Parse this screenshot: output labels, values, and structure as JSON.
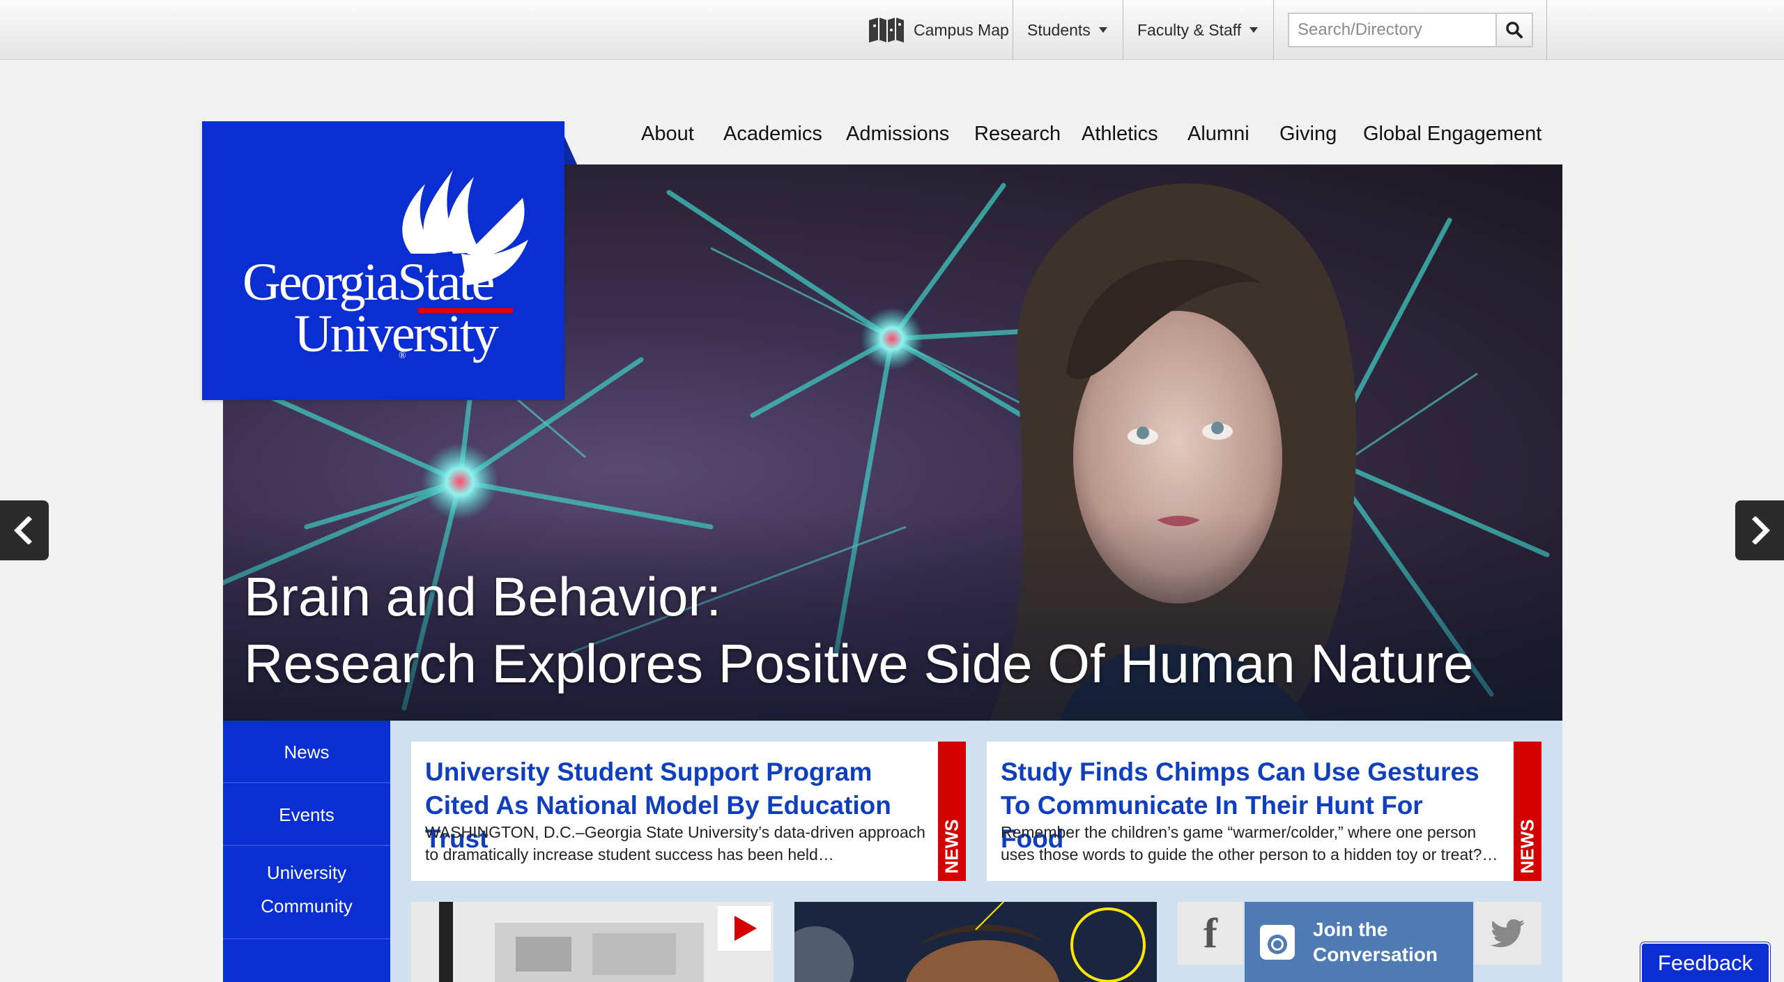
{
  "utility": {
    "campus_map": "Campus Map",
    "students": "Students",
    "faculty_staff": "Faculty & Staff",
    "search_placeholder": "Search/Directory"
  },
  "logo": {
    "line1": "GeorgiaState",
    "line2": "University"
  },
  "nav": [
    "About",
    "Academics",
    "Admissions",
    "Research",
    "Athletics",
    "Alumni",
    "Giving",
    "Global Engagement"
  ],
  "hero": {
    "title_line1": "Brain and Behavior:",
    "title_line2": "Research Explores Positive Side Of Human Nature"
  },
  "sidebar": [
    "News",
    "Events",
    "University Community"
  ],
  "cards": [
    {
      "title": "University Student Support Program Cited As National Model By Education Trust",
      "excerpt": "WASHINGTON, D.C.–Georgia State University’s data-driven approach to dramatically increase student success has been held…",
      "tag": "NEWS"
    },
    {
      "title": "Study Finds Chimps Can Use Gestures To Communicate In Their Hunt For Food",
      "excerpt": "Remember the children’s game “warmer/colder,” where one person uses those words to guide the other person to a hidden toy or treat?…",
      "tag": "NEWS"
    }
  ],
  "social": {
    "join": "Join the Conversation",
    "facebook_glyph": "f"
  },
  "feedback": "Feedback",
  "colors": {
    "brand_blue": "#0a2ed1",
    "news_red": "#d40000",
    "link_blue": "#0f3fbd"
  }
}
